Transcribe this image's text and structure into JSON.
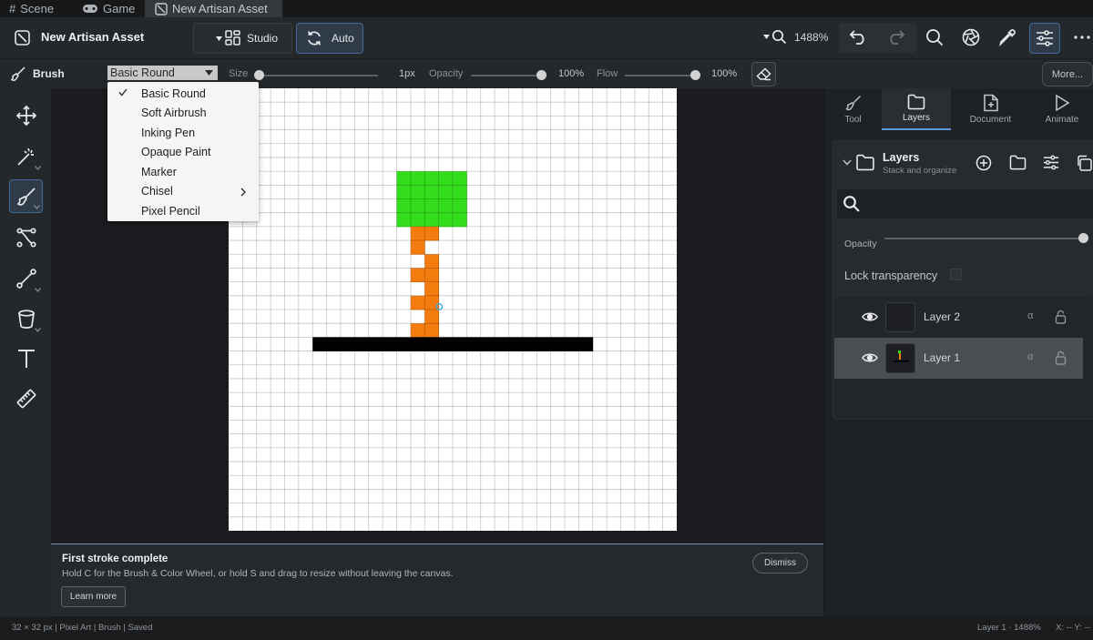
{
  "tabs": [
    {
      "label": "Scene"
    },
    {
      "label": "Game"
    },
    {
      "label": "New Artisan Asset"
    }
  ],
  "header": {
    "title": "New Artisan Asset",
    "studio_label": "Studio",
    "auto_label": "Auto",
    "zoom_label": "1488%"
  },
  "options": {
    "tool_name": "Brush",
    "brush_selected": "Basic Round",
    "size_label": "Size",
    "size_value": "1px",
    "size_level": 0.0,
    "opacity_label": "Opacity",
    "opacity_value": "100%",
    "opacity_level": 1.0,
    "flow_label": "Flow",
    "flow_value": "100%",
    "flow_level": 1.0,
    "more_label": "More..."
  },
  "brush_menu": {
    "items": [
      {
        "label": "Basic Round",
        "checked": true,
        "submenu": false
      },
      {
        "label": "Soft Airbrush",
        "checked": false,
        "submenu": false
      },
      {
        "label": "Inking Pen",
        "checked": false,
        "submenu": false
      },
      {
        "label": "Opaque Paint",
        "checked": false,
        "submenu": false
      },
      {
        "label": "Marker",
        "checked": false,
        "submenu": false
      },
      {
        "label": "Chisel",
        "checked": false,
        "submenu": true
      },
      {
        "label": "Pixel Pencil",
        "checked": false,
        "submenu": false
      }
    ]
  },
  "tools": [
    {
      "icon": "move-icon"
    },
    {
      "icon": "magic-wand-icon"
    },
    {
      "icon": "brush-icon"
    },
    {
      "icon": "bezier-icon"
    },
    {
      "icon": "line-icon"
    },
    {
      "icon": "bucket-icon"
    },
    {
      "icon": "text-icon"
    },
    {
      "icon": "ruler-icon"
    }
  ],
  "panel": {
    "tabs": [
      {
        "label": "Tool"
      },
      {
        "label": "Layers"
      },
      {
        "label": "Document"
      },
      {
        "label": "Animate"
      }
    ],
    "layers_title": "Layers",
    "layers_subtitle": "Stack and organize",
    "opacity_label": "Opacity",
    "opacity_level": 1.0,
    "lock_label": "Lock transparency",
    "alpha_glyph": "α",
    "layers": [
      {
        "name": "Layer 2",
        "selected": false
      },
      {
        "name": "Layer 1",
        "selected": true
      }
    ]
  },
  "toast": {
    "title": "First stroke complete",
    "body": "Hold C for the Brush & Color Wheel, or hold S and drag to resize without leaving the canvas.",
    "dismiss_label": "Dismiss",
    "learn_label": "Learn more"
  },
  "status": {
    "left": "32 × 32 px | Pixel Art | Brush | Saved",
    "right": "Layer 1 · 1488%",
    "coords": "X: -- Y: --"
  },
  "colors": {
    "accent": "#3d6b96",
    "green": "#33dd1c",
    "orange": "#f47c0e",
    "black": "#000000"
  }
}
